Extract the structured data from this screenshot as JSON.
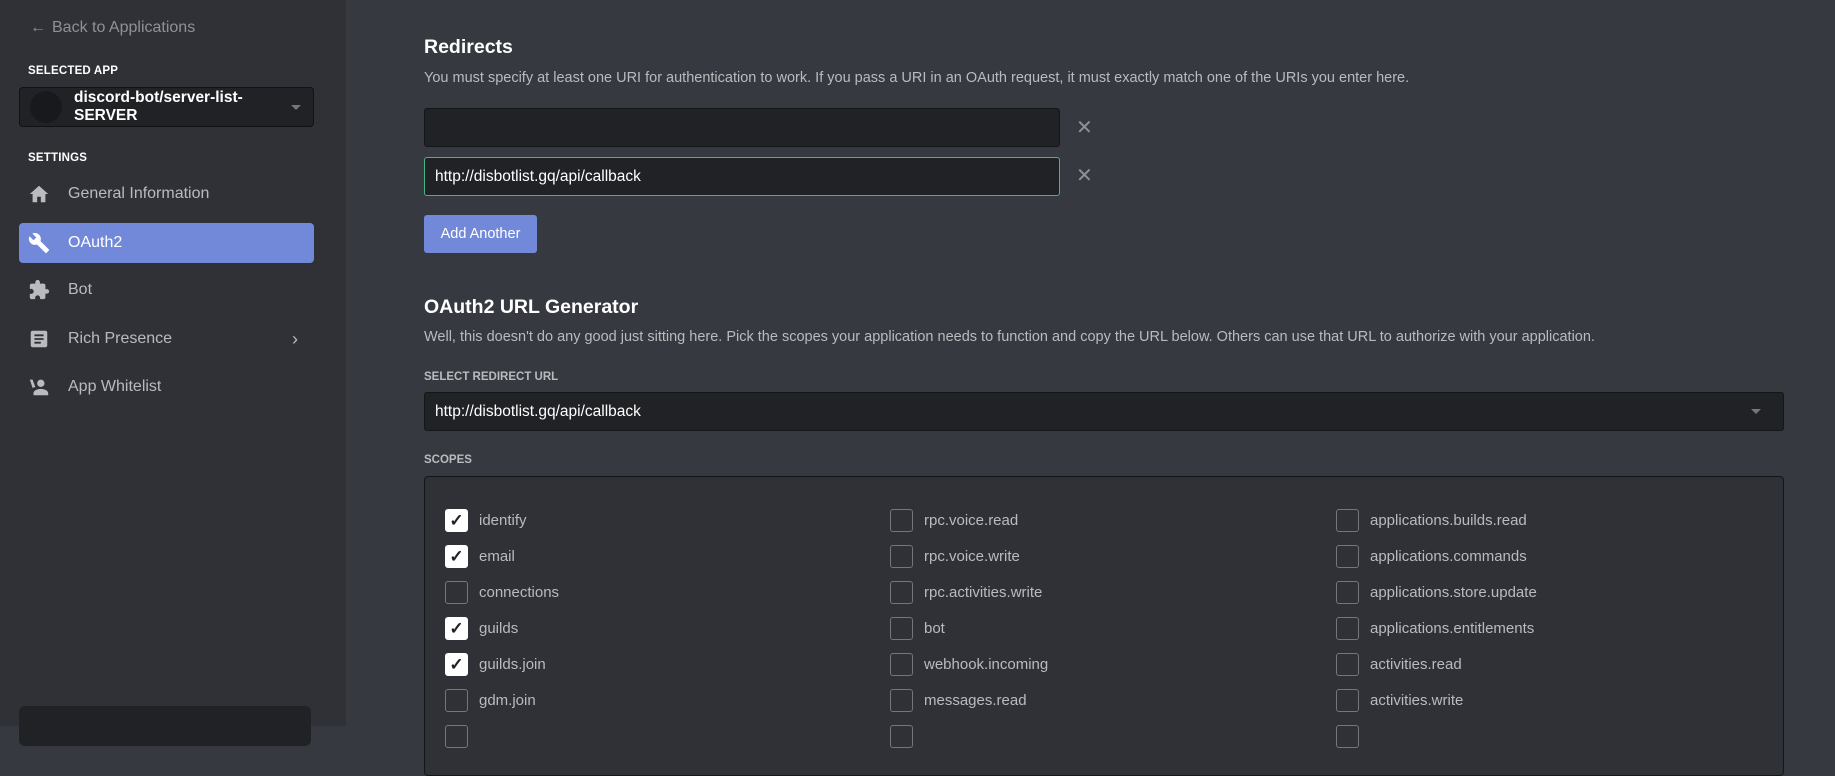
{
  "sidebar": {
    "back": "Back to Applications",
    "selected_app_label": "SELECTED APP",
    "app_name": "discord-bot/server-list-SERVER",
    "settings_label": "SETTINGS",
    "items": [
      {
        "label": "General Information",
        "icon": "home-icon"
      },
      {
        "label": "OAuth2",
        "icon": "wrench-icon",
        "active": true
      },
      {
        "label": "Bot",
        "icon": "puzzle-icon"
      },
      {
        "label": "Rich Presence",
        "icon": "document-icon"
      },
      {
        "label": "App Whitelist",
        "icon": "user-whitelist-icon"
      }
    ]
  },
  "redirects": {
    "title": "Redirects",
    "description": "You must specify at least one URI for authentication to work. If you pass a URI in an OAuth request, it must exactly match one of the URIs you enter here.",
    "uris": [
      "",
      "http://disbotlist.gq/api/callback"
    ],
    "add_label": "Add Another"
  },
  "generator": {
    "title": "OAuth2 URL Generator",
    "description": "Well, this doesn't do any good just sitting here. Pick the scopes your application needs to function and copy the URL below. Others can use that URL to authorize with your application.",
    "select_label": "SELECT REDIRECT URL",
    "selected_url": "http://disbotlist.gq/api/callback",
    "scopes_label": "SCOPES",
    "scopes": [
      [
        {
          "name": "identify",
          "checked": true
        },
        {
          "name": "email",
          "checked": true
        },
        {
          "name": "connections",
          "checked": false
        },
        {
          "name": "guilds",
          "checked": true
        },
        {
          "name": "guilds.join",
          "checked": true
        },
        {
          "name": "gdm.join",
          "checked": false
        }
      ],
      [
        {
          "name": "rpc.voice.read",
          "checked": false
        },
        {
          "name": "rpc.voice.write",
          "checked": false
        },
        {
          "name": "rpc.activities.write",
          "checked": false
        },
        {
          "name": "bot",
          "checked": false
        },
        {
          "name": "webhook.incoming",
          "checked": false
        },
        {
          "name": "messages.read",
          "checked": false
        }
      ],
      [
        {
          "name": "applications.builds.read",
          "checked": false
        },
        {
          "name": "applications.commands",
          "checked": false
        },
        {
          "name": "applications.store.update",
          "checked": false
        },
        {
          "name": "applications.entitlements",
          "checked": false
        },
        {
          "name": "activities.read",
          "checked": false
        },
        {
          "name": "activities.write",
          "checked": false
        }
      ]
    ]
  }
}
